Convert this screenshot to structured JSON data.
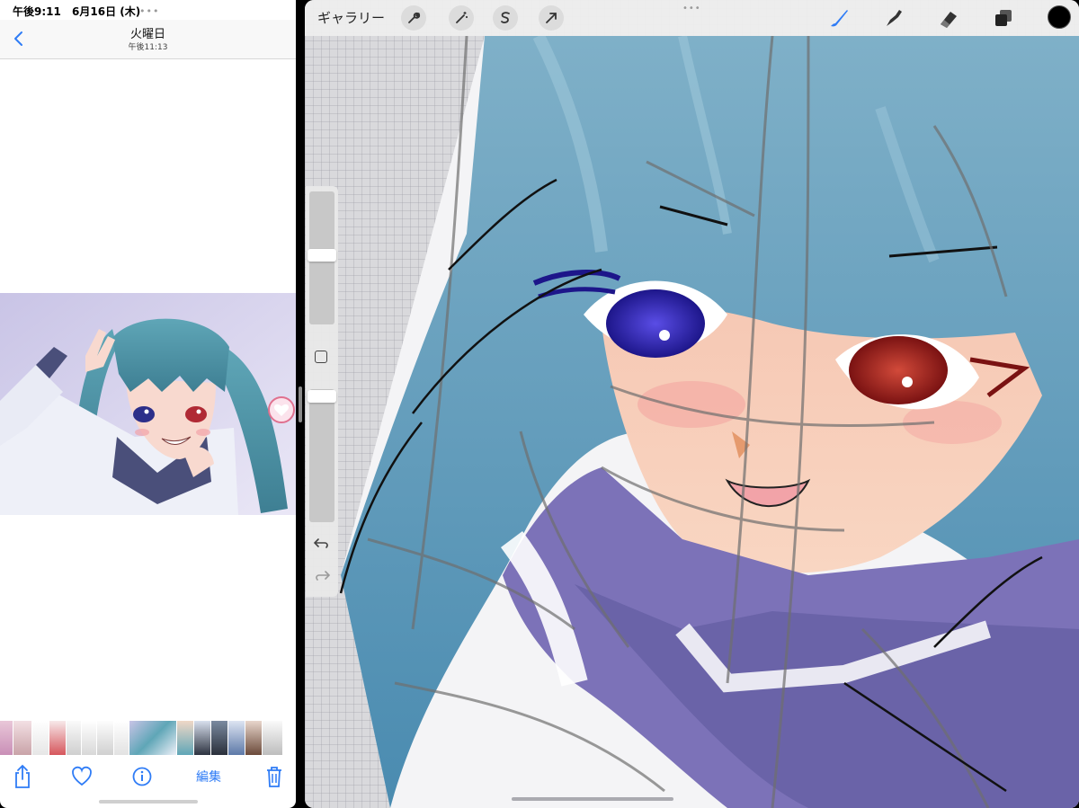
{
  "status_bar": {
    "time": "午後9:11",
    "date": "6月16日 (木)"
  },
  "photos": {
    "nav": {
      "title": "火曜日",
      "subtitle": "午後11:13"
    },
    "toolbar": {
      "edit_label": "編集"
    },
    "filmstrip_count": 15,
    "icons": [
      "back-chevron-icon",
      "share-icon",
      "heart-icon",
      "info-icon",
      "trash-icon"
    ]
  },
  "procreate": {
    "gallery_label": "ギャラリー",
    "actions_tools": [
      "wrench-icon",
      "magic-wand-icon",
      "selection-icon",
      "transform-arrow-icon"
    ],
    "right_tools": [
      "brush-icon",
      "smudge-icon",
      "eraser-icon",
      "layers-icon"
    ],
    "current_color": "#000000",
    "brush_active_color": "#2f7cf6",
    "sidebar": {
      "brush_size_level": 0.45,
      "opacity_level": 0.02
    }
  },
  "colors": {
    "ios_blue": "#2f7cf6",
    "toolbar_bg": "#eeeeee"
  }
}
